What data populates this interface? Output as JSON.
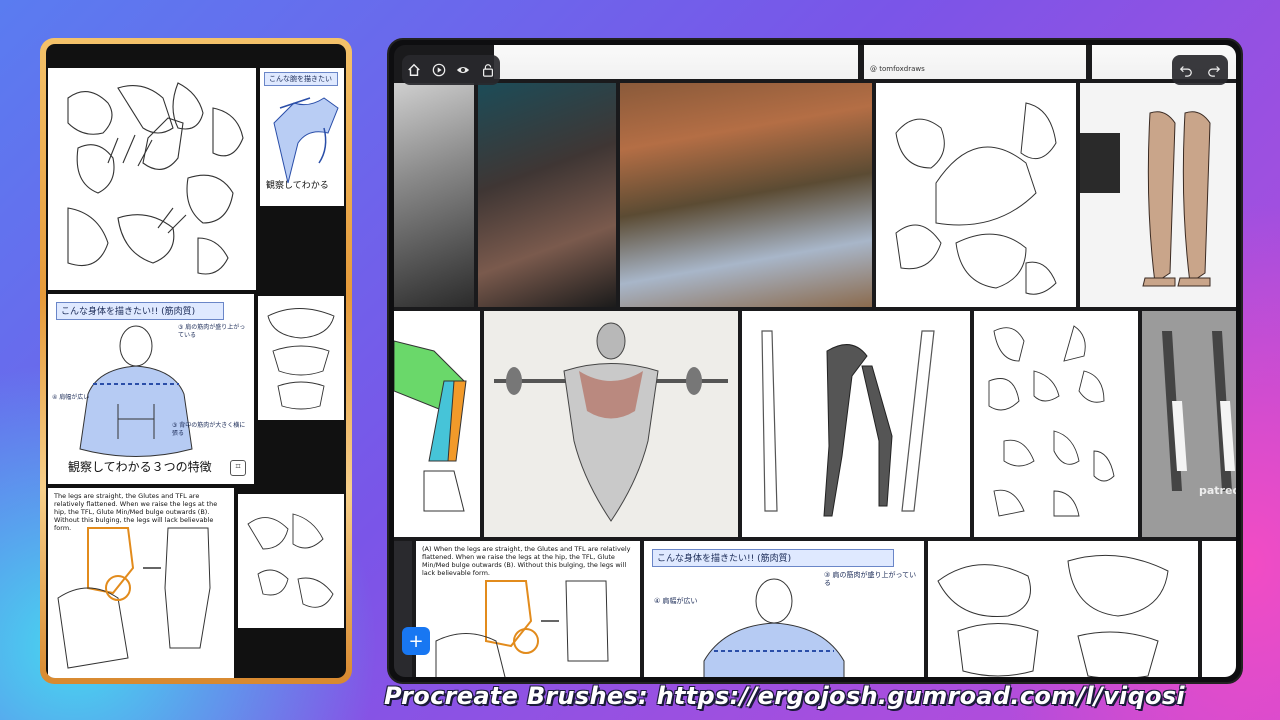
{
  "phone": {
    "tiles": {
      "arm_title": "こんな腕を描きたい",
      "arm_caption": "観察してわかる",
      "torso_title": "こんな身体を描きたい!! (筋肉質)",
      "torso_note_top": "③ 肩の筋肉が盛り上がっている",
      "torso_note_left": "④ 肩幅が広い",
      "torso_note_bottom": "③ 背中の筋肉が大きく横に張る",
      "torso_caption": "観察してわかる３つの特徴",
      "legs_text": "The legs are straight, the Glutes and TFL are relatively flattened. When we raise the legs at the hip, the TFL, Glute Min/Med bulge outwards (B). Without this bulging, the legs will lack believable form."
    }
  },
  "board": {
    "credit": "@ tomfoxdraws",
    "legs_text": "(A) When the legs are straight, the Glutes and TFL are relatively flattened. When we raise the legs at the hip, the TFL, Glute Min/Med bulge outwards (B). Without this bulging, the legs will lack believable form.",
    "torso_title": "こんな身体を描きたい!! (筋肉質)",
    "torso_note_top": "③ 肩の筋肉が盛り上がっている",
    "torso_note_left": "④ 肩幅が広い",
    "side_label": "patreo",
    "add_label": "+"
  },
  "caption": "Procreate Brushes: https://ergojosh.gumroad.com/l/viqosi",
  "icons": {
    "toolbar": [
      "home-icon",
      "play-icon",
      "eye-icon",
      "lock-icon"
    ],
    "toolbar_right": [
      "undo-icon",
      "redo-icon"
    ]
  }
}
